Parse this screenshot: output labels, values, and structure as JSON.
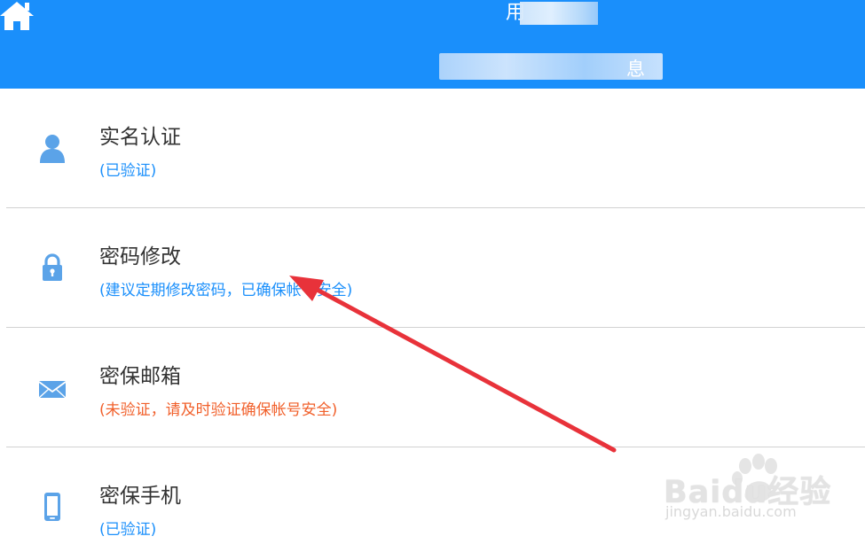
{
  "header": {
    "title": "用",
    "subtitle": "息"
  },
  "rows": [
    {
      "title": "实名认证",
      "status": "(已验证)",
      "icon": "user-icon"
    },
    {
      "title": "密码修改",
      "status": "(建议定期修改密码，已确保帐号安全)",
      "icon": "lock-icon"
    },
    {
      "title": "密保邮箱",
      "status": "(未验证，请及时验证确保帐号安全)",
      "icon": "mail-icon"
    },
    {
      "title": "密保手机",
      "status": "(已验证)",
      "icon": "phone-icon"
    }
  ],
  "watermark": {
    "brand": "Baidu经验",
    "url": "jingyan.baidu.com"
  },
  "colors": {
    "header": "#1a8ffb",
    "status_ok": "#1a8ffb",
    "status_warning": "#f1602b",
    "annotation_arrow": "#e8323a"
  }
}
